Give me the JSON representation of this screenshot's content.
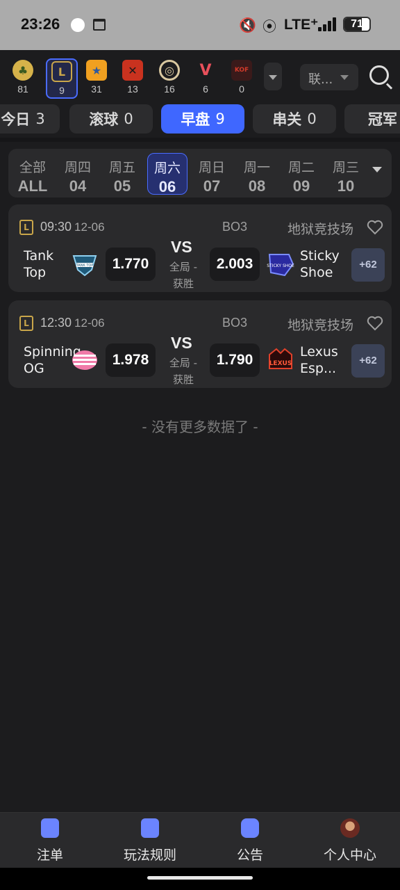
{
  "status_bar": {
    "time": "23:26",
    "network": "LTE⁺",
    "battery": "71"
  },
  "games": [
    {
      "name": "clover",
      "count": "81",
      "color": "#d6b24a"
    },
    {
      "name": "lol",
      "count": "9",
      "color": "#c9a64a",
      "active": true
    },
    {
      "name": "csgo",
      "count": "31",
      "color": "#f0a020"
    },
    {
      "name": "dota2",
      "count": "13",
      "color": "#c9321f"
    },
    {
      "name": "overwatch",
      "count": "16",
      "color": "#d9c8a0"
    },
    {
      "name": "valorant",
      "count": "6",
      "color": "#e8505b"
    },
    {
      "name": "kof",
      "count": "0",
      "color": "#d23a2a"
    }
  ],
  "header": {
    "lang_label": "联..."
  },
  "tabs": [
    {
      "label": "今日",
      "count": "3"
    },
    {
      "label": "滚球",
      "count": "0"
    },
    {
      "label": "早盘",
      "count": "9",
      "active": true
    },
    {
      "label": "串关",
      "count": "0"
    },
    {
      "label": "冠军",
      "count": ""
    }
  ],
  "dates": [
    {
      "day": "全部",
      "num": "ALL"
    },
    {
      "day": "周四",
      "num": "04"
    },
    {
      "day": "周五",
      "num": "05"
    },
    {
      "day": "周六",
      "num": "06",
      "active": true
    },
    {
      "day": "周日",
      "num": "07"
    },
    {
      "day": "周一",
      "num": "08"
    },
    {
      "day": "周二",
      "num": "09"
    },
    {
      "day": "周三",
      "num": "10"
    }
  ],
  "matches": [
    {
      "time": "09:30",
      "date": "12-06",
      "bo": "BO3",
      "league": "地狱竞技场",
      "team_left": "Tank Top",
      "team_right": "Sticky Shoe",
      "odd_left": "1.770",
      "odd_right": "2.003",
      "vs": "VS",
      "market": "全局 - 获胜",
      "more": "+62",
      "logo_left_text": "TANK TOP",
      "logo_right_text": "STICKY SHOE"
    },
    {
      "time": "12:30",
      "date": "12-06",
      "bo": "BO3",
      "league": "地狱竞技场",
      "team_left": "Spinning OG",
      "team_right": "Lexus Esp...",
      "odd_left": "1.978",
      "odd_right": "1.790",
      "vs": "VS",
      "market": "全局 - 获胜",
      "more": "+62",
      "logo_right_text": "LEXUS"
    }
  ],
  "no_more_text": "- 没有更多数据了 -",
  "bottom_nav": [
    {
      "label": "注单",
      "icon": "orders-icon"
    },
    {
      "label": "玩法规则",
      "icon": "rules-icon"
    },
    {
      "label": "公告",
      "icon": "announcement-icon"
    },
    {
      "label": "个人中心",
      "icon": "avatar"
    }
  ],
  "colors": {
    "accent": "#3f67ff",
    "background": "#1c1c1e",
    "card": "#2a2a2c"
  }
}
